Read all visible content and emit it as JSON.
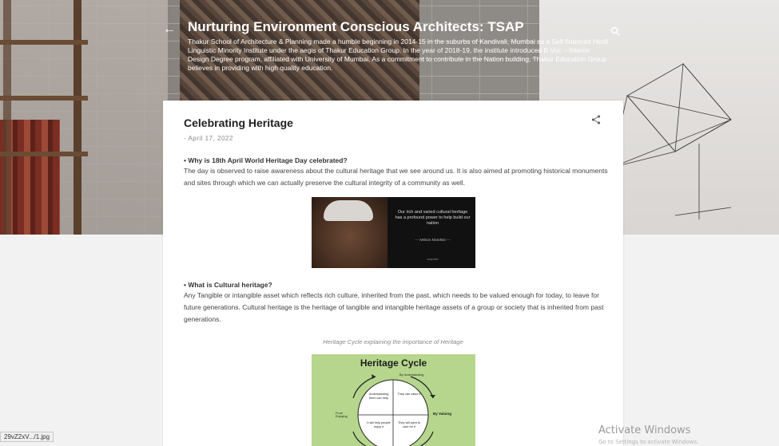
{
  "header": {
    "back_glyph": "←",
    "title": "Nurturing Environment Conscious Architects: TSAP",
    "description": "Thakur School of Architecture & Planning made a humble beginning in 2014-15 in the suburbs of Kandivali, Mumbai as a Self financed Hindi Linguistic Minority Institute under the aegis of Thakur Education Group. In the year of 2018-19, the institute introduced B.Voc – Interior Design Degree program, affiliated with University of Mumbai. As a commitment to contribute in the Nation building, Thakur Education Group believes in providing with high quality education.",
    "search_icon": "search-icon"
  },
  "post": {
    "title": "Celebrating Heritage",
    "date": "- April 17, 2022",
    "share_icon": "share-icon",
    "q1": "• Why is 18th April World Heritage Day celebrated?",
    "p1": "The day is observed to raise awareness about the cultural heritage that we see around us. It is also aimed at promoting historical monuments and sites through which we can actually preserve the cultural integrity of a community as well.",
    "image1": {
      "quote": "Our rich and varied cultural heritage has a profound power to help build our nation",
      "author": "— Nelson Mandela —",
      "source": "azquotes"
    },
    "q2": "• What is Cultural heritage?",
    "p2": "Any Tangible or intangible asset which reflects rich culture, inherited from the past, which needs to be valued enough for today, to leave for future generations. Cultural heritage is the heritage of tangible and intangible heritage assets of a group or society that is inherited from past generations.",
    "caption": "Heritage Cycle explaining the importance of Heritage",
    "image2": {
      "title": "Heritage Cycle",
      "top_label": "By Understanding",
      "right_label": "By Valuing",
      "left_label": "From Enjoying",
      "q1": "Understanding them can help",
      "q2": "They can value it",
      "q3": "It will help people enjoy it",
      "q4": "They will want to care for it"
    }
  },
  "status_bar": {
    "url": "29vZ2xV.../1.jpg"
  },
  "watermark": {
    "title": "Activate Windows",
    "subtitle": "Go to Settings to activate Windows."
  },
  "colors": {
    "accent_green": "#b6d68d",
    "title_text": "#212121"
  }
}
